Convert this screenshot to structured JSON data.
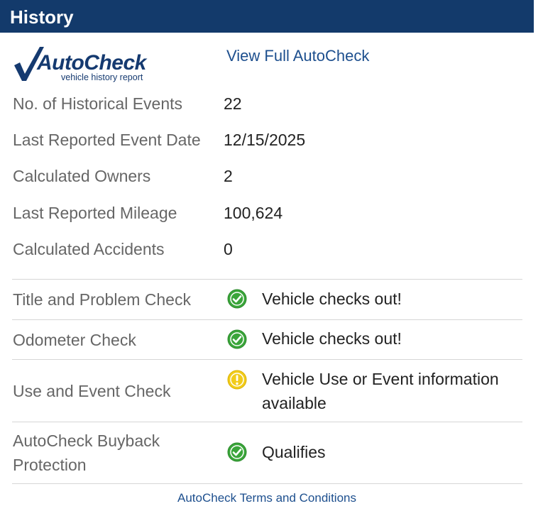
{
  "header": {
    "title": "History"
  },
  "logo": {
    "word": "AutoCheck",
    "sub": "vehicle history report"
  },
  "link": {
    "full": "View Full AutoCheck"
  },
  "stats": [
    {
      "label": "No. of Historical Events",
      "value": "22"
    },
    {
      "label": "Last Reported Event Date",
      "value": "12/15/2025"
    },
    {
      "label": "Calculated Owners",
      "value": "2"
    },
    {
      "label": "Last Reported Mileage",
      "value": "100,624"
    },
    {
      "label": "Calculated Accidents",
      "value": "0"
    }
  ],
  "checks": [
    {
      "label": "Title and Problem Check",
      "status": "ok",
      "icon": "green-check-icon",
      "text": "Vehicle checks out!"
    },
    {
      "label": "Odometer Check",
      "status": "ok",
      "icon": "green-check-icon",
      "text": "Vehicle checks out!"
    },
    {
      "label": "Use and Event Check",
      "status": "warning",
      "icon": "yellow-alert-icon",
      "text": "Vehicle Use or Event information available"
    },
    {
      "label_line1": "AutoCheck Buyback",
      "label_line2": "Protection",
      "status": "ok",
      "icon": "green-check-icon",
      "text": "Qualifies"
    }
  ],
  "footer": {
    "terms": "AutoCheck Terms and Conditions"
  },
  "colors": {
    "header": "#133a6b",
    "link": "#1d4f8e",
    "ok": "#3aa53a",
    "warning": "#f2cc1b"
  }
}
